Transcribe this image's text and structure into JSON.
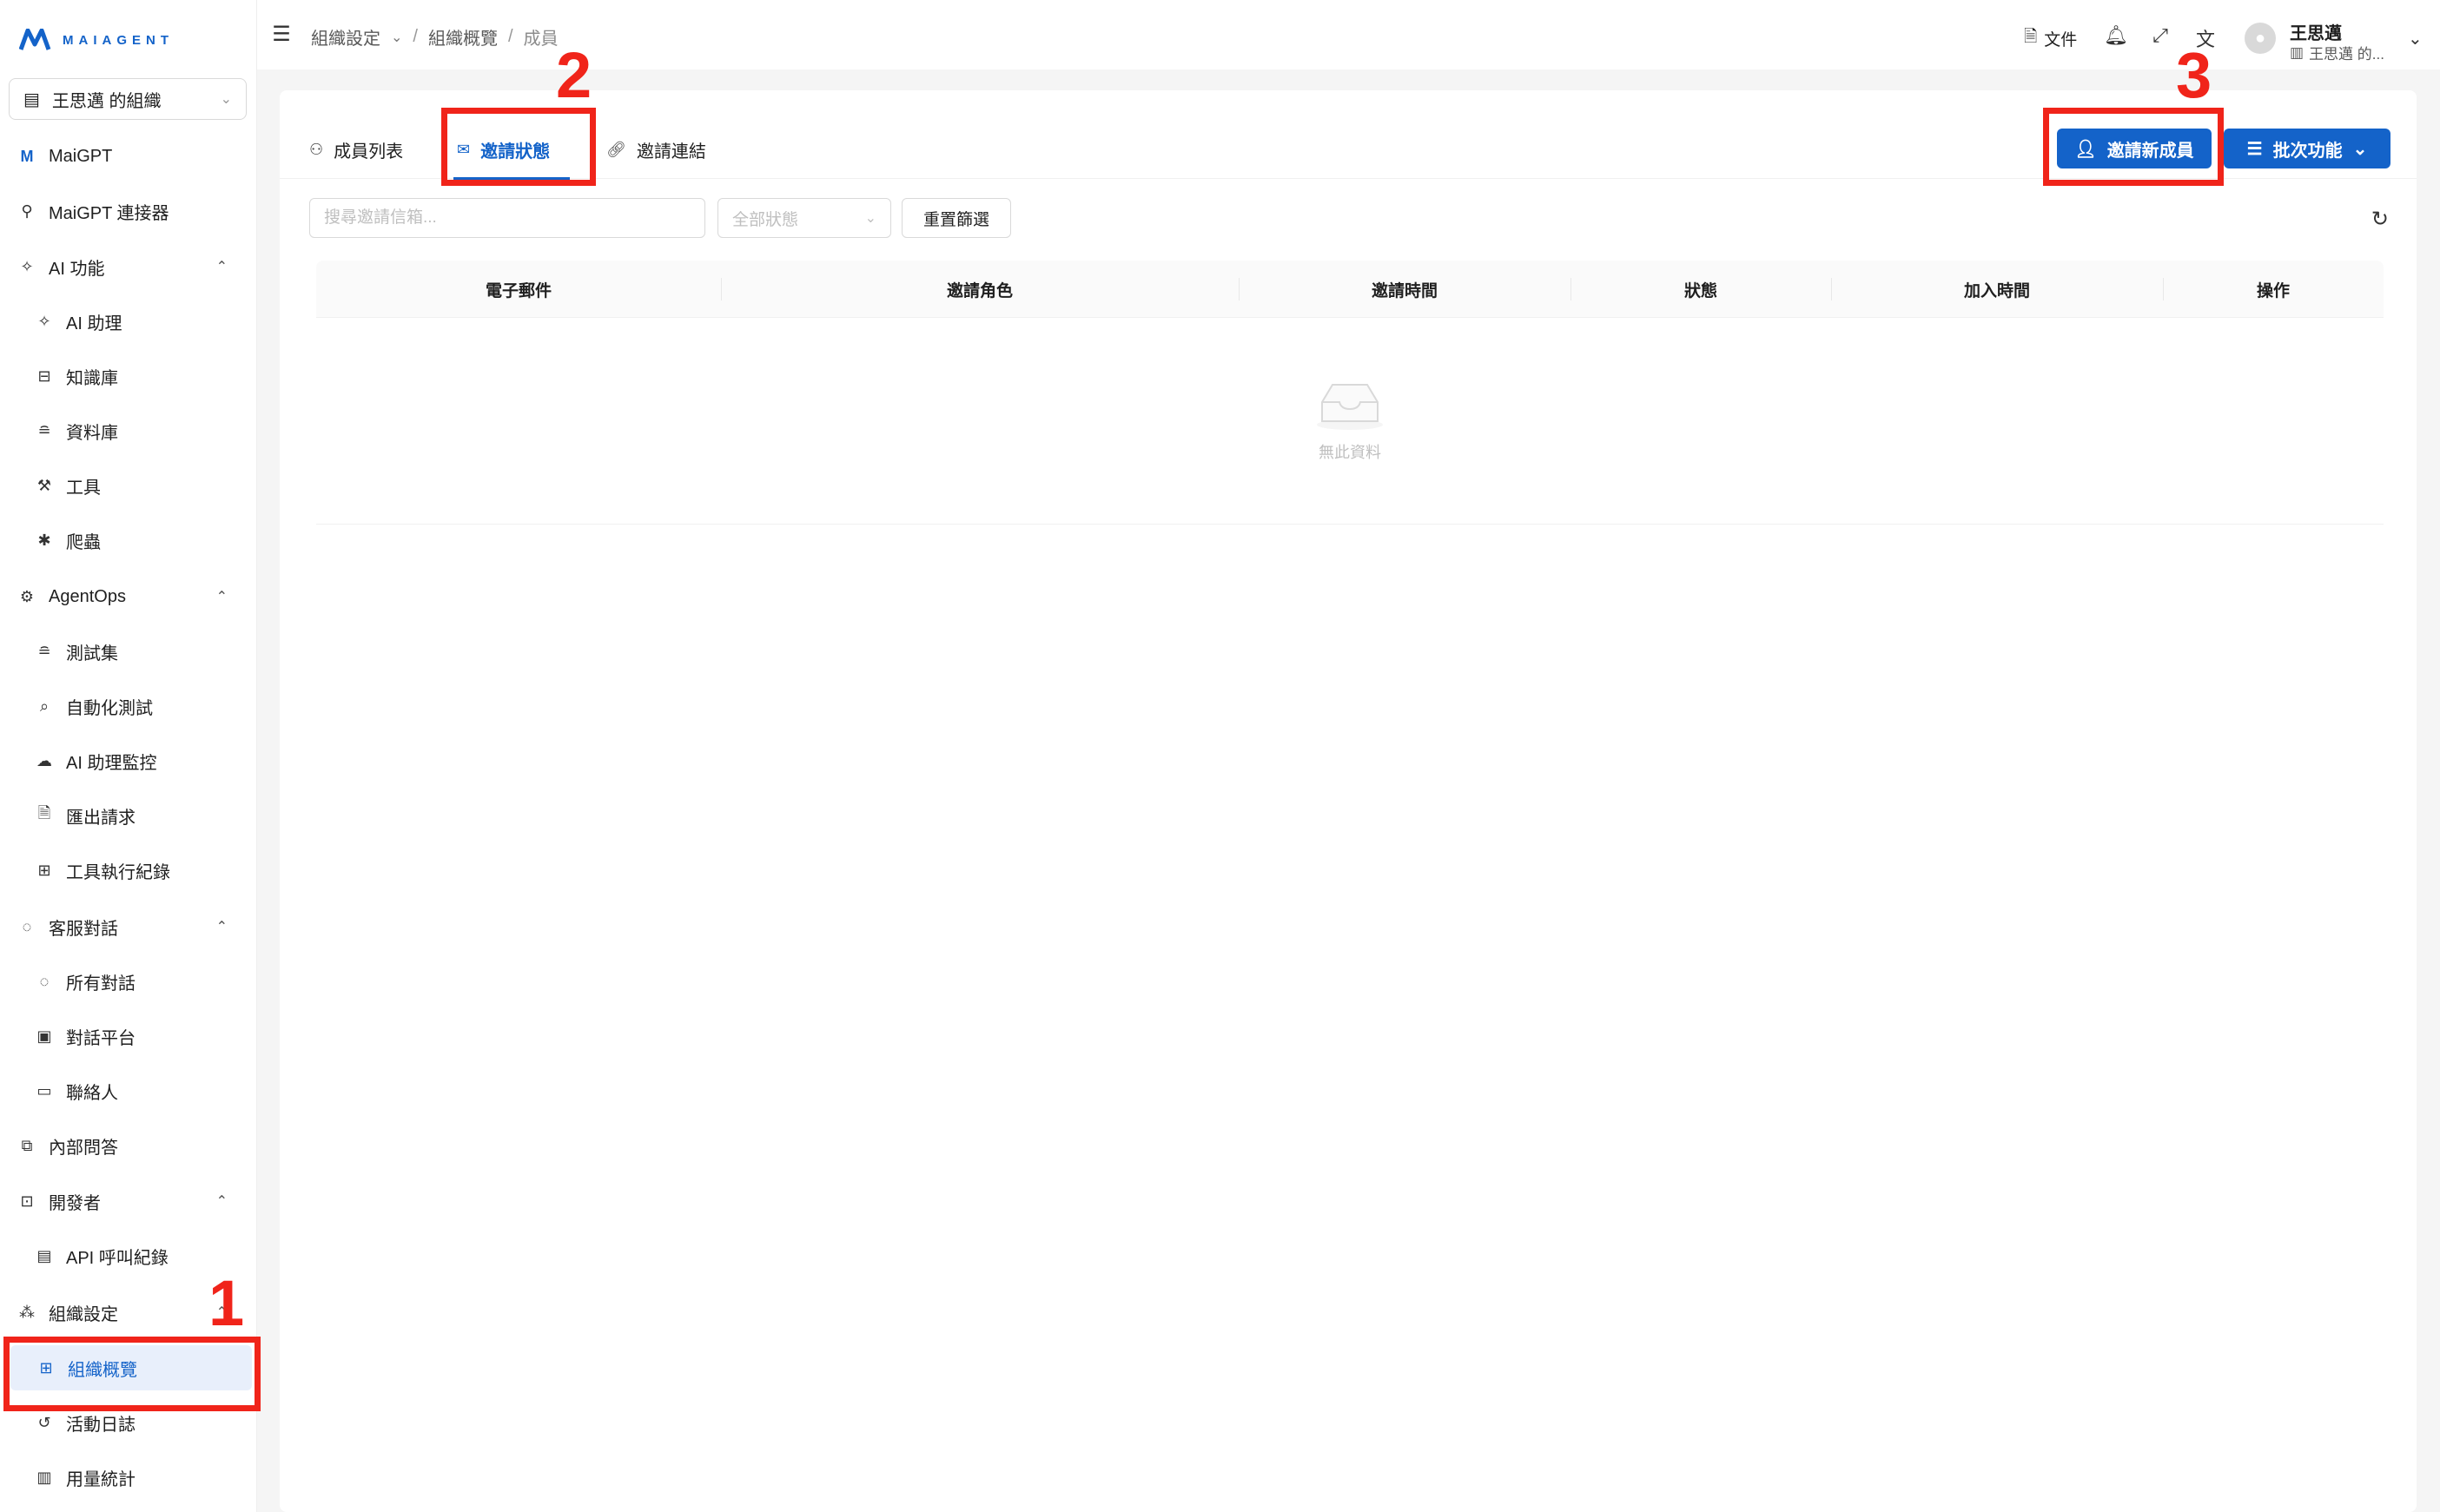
{
  "app": {
    "logo_text": "MAIAGENT",
    "accent": "#1463c9",
    "annotation_color": "#f0241a"
  },
  "sidebar": {
    "org_select": "王思邁 的組織",
    "items": [
      {
        "label": "MaiGPT",
        "icon": "maiagent-logo-icon",
        "level": 1
      },
      {
        "label": "MaiGPT 連接器",
        "icon": "plug-icon",
        "level": 1
      },
      {
        "label": "AI 功能",
        "icon": "sparkle-icon",
        "level": 1,
        "expanded": true
      },
      {
        "label": "AI 助理",
        "icon": "sparkle-icon",
        "level": 2
      },
      {
        "label": "知識庫",
        "icon": "book-icon",
        "level": 2
      },
      {
        "label": "資料庫",
        "icon": "database-icon",
        "level": 2
      },
      {
        "label": "工具",
        "icon": "wrench-icon",
        "level": 2
      },
      {
        "label": "爬蟲",
        "icon": "bug-icon",
        "level": 2
      },
      {
        "label": "AgentOps",
        "icon": "agentops-icon",
        "level": 1,
        "expanded": true
      },
      {
        "label": "測試集",
        "icon": "database-icon",
        "level": 2
      },
      {
        "label": "自動化測試",
        "icon": "magnify-icon",
        "level": 2
      },
      {
        "label": "AI 助理監控",
        "icon": "cloud-monitor-icon",
        "level": 2
      },
      {
        "label": "匯出請求",
        "icon": "file-export-icon",
        "level": 2
      },
      {
        "label": "工具執行紀錄",
        "icon": "toolbox-icon",
        "level": 2
      },
      {
        "label": "客服對話",
        "icon": "chat-icon",
        "level": 1,
        "expanded": true
      },
      {
        "label": "所有對話",
        "icon": "chat-icon",
        "level": 2
      },
      {
        "label": "對話平台",
        "icon": "platform-icon",
        "level": 2
      },
      {
        "label": "聯絡人",
        "icon": "contact-card-icon",
        "level": 2
      },
      {
        "label": "內部問答",
        "icon": "qa-icon",
        "level": 1
      },
      {
        "label": "開發者",
        "icon": "code-icon",
        "level": 1,
        "expanded": true
      },
      {
        "label": "API 呼叫紀錄",
        "icon": "document-icon",
        "level": 2
      },
      {
        "label": "組織設定",
        "icon": "team-icon",
        "level": 1,
        "expanded": true
      },
      {
        "label": "組織概覽",
        "icon": "grid-icon",
        "level": 2,
        "active": true
      },
      {
        "label": "活動日誌",
        "icon": "history-icon",
        "level": 2
      },
      {
        "label": "用量統計",
        "icon": "bar-chart-icon",
        "level": 2
      }
    ]
  },
  "header": {
    "breadcrumb": [
      "組織設定",
      "組織概覽",
      "成員"
    ],
    "doc_label": "文件",
    "user_name": "王思邁",
    "user_org": "王思邁 的..."
  },
  "main": {
    "tabs": [
      {
        "label": "成員列表",
        "icon": "members-icon"
      },
      {
        "label": "邀請狀態",
        "icon": "mail-icon",
        "active": true
      },
      {
        "label": "邀請連結",
        "icon": "link-icon"
      }
    ],
    "invite_button": "邀請新成員",
    "batch_button": "批次功能",
    "search_placeholder": "搜尋邀請信箱...",
    "status_filter": "全部狀態",
    "reset_button": "重置篩選",
    "table_headers": [
      "電子郵件",
      "邀請角色",
      "邀請時間",
      "狀態",
      "加入時間",
      "操作"
    ],
    "empty_text": "無此資料"
  },
  "annotations": [
    "1",
    "2",
    "3"
  ]
}
